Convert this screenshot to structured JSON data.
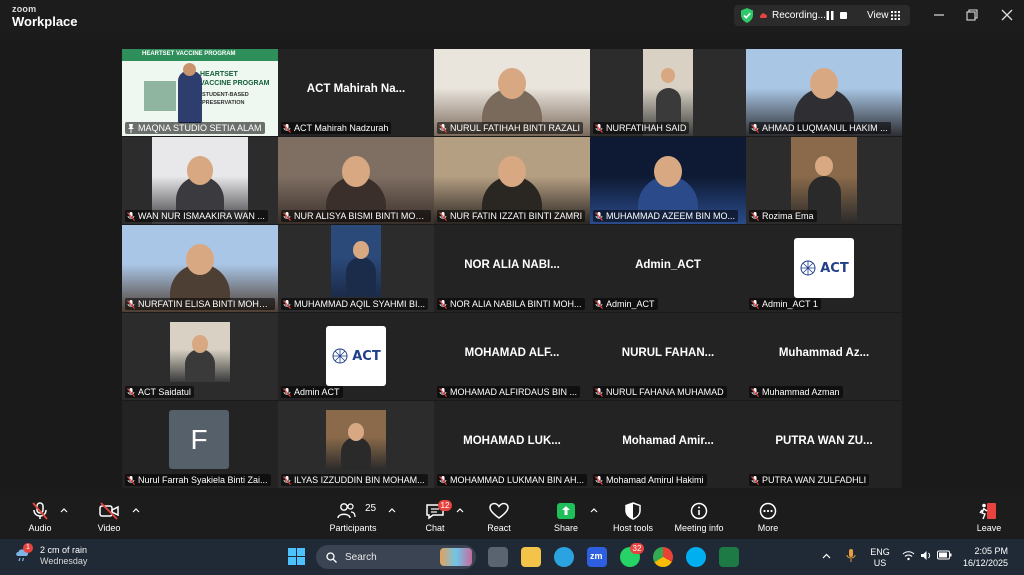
{
  "app": {
    "brand_top": "zoom",
    "brand_bottom": "Workplace"
  },
  "recording": {
    "label": "Recording...",
    "view_label": "View"
  },
  "gallery": {
    "participants": [
      {
        "name": "MAQNA STUDIO SETIA ALAM",
        "video": true,
        "active": true,
        "pinned": true
      },
      {
        "name": "ACT Mahirah Nadzurah",
        "video": false,
        "big_name": "ACT Mahirah Na..."
      },
      {
        "name": "NURUL FATIHAH BINTI RAZALI",
        "video": true
      },
      {
        "name": "NURFATIHAH SAID",
        "video": true
      },
      {
        "name": "AHMAD LUQMANUL HAKIM ...",
        "video": true
      },
      {
        "name": "WAN NUR ISMAAKIRA WAN ...",
        "video": true
      },
      {
        "name": "NUR ALISYA BISMI BINTI MOH...",
        "video": true
      },
      {
        "name": "NUR FATIN IZZATI BINTI ZAMRI",
        "video": true
      },
      {
        "name": "MUHAMMAD AZEEM BIN MO...",
        "video": true
      },
      {
        "name": "Rozima Ema",
        "video": true
      },
      {
        "name": "NURFATIN ELISA BINTI MOHA...",
        "video": true
      },
      {
        "name": "MUHAMMAD AQIL SYAHMI BI...",
        "video": true
      },
      {
        "name": "NOR ALIA NABILA BINTI MOH...",
        "video": false,
        "big_name": "NOR ALIA NABI..."
      },
      {
        "name": "Admin_ACT",
        "video": false,
        "big_name": "Admin_ACT"
      },
      {
        "name": "Admin_ACT 1",
        "video": false,
        "logo": "ACT"
      },
      {
        "name": "ACT Saidatul",
        "video": true
      },
      {
        "name": "Admin ACT",
        "video": false,
        "logo": "ACT"
      },
      {
        "name": "MOHAMAD ALFIRDAUS BIN ...",
        "video": false,
        "big_name": "MOHAMAD ALF..."
      },
      {
        "name": "NURUL FAHANA MUHAMAD",
        "video": false,
        "big_name": "NURUL FAHAN..."
      },
      {
        "name": "Muhammad Azman",
        "video": false,
        "big_name": "Muhammad Az..."
      },
      {
        "name": "Nurul Farrah Syakiela Binti Zai...",
        "video": false,
        "avatar": "F"
      },
      {
        "name": "ILYAS IZZUDDIN BIN MOHAM...",
        "video": true
      },
      {
        "name": "MOHAMMAD LUKMAN BIN AH...",
        "video": false,
        "big_name": "MOHAMAD LUK..."
      },
      {
        "name": "Mohamad Amirul Hakimi",
        "video": false,
        "big_name": "Mohamad Amir..."
      },
      {
        "name": "PUTRA WAN ZULFADHLI",
        "video": false,
        "big_name": "PUTRA WAN ZU..."
      }
    ],
    "slide_text": {
      "line1": "HEARTSET VACCINE PROGRAM",
      "line2": "HEARTSET",
      "line3": "VACCINE PROGRAM",
      "line4": "STUDENT-BASED",
      "line5": "PRESERVATION"
    }
  },
  "toolbar": {
    "audio": "Audio",
    "video": "Video",
    "participants": "Participants",
    "participants_count": "25",
    "chat": "Chat",
    "chat_badge": "12",
    "react": "React",
    "share": "Share",
    "host_tools": "Host tools",
    "meeting_info": "Meeting info",
    "more": "More",
    "leave": "Leave"
  },
  "taskbar": {
    "weather_line1": "2 cm of rain",
    "weather_line2": "Wednesday",
    "weather_badge": "1",
    "search_placeholder": "Search",
    "whatsapp_badge": "32",
    "lang_line1": "ENG",
    "lang_line2": "US",
    "time": "2:05 PM",
    "date": "16/12/2025"
  },
  "colors": {
    "active_speaker": "#2dc96a",
    "share_green": "#1fbf5a",
    "leave_red": "#e8433f",
    "badge_red": "#e8433f",
    "act_blue": "#1f3f8a"
  }
}
